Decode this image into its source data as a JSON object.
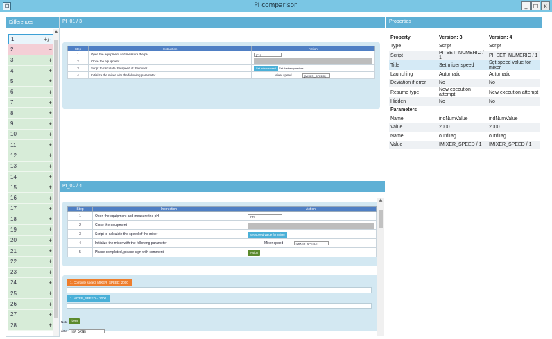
{
  "window": {
    "title": "PI comparison",
    "icon": "app-icon",
    "min": "_",
    "max": "□",
    "close": "x"
  },
  "differences": {
    "header": "Differences",
    "items": [
      {
        "n": "1",
        "sign": "+/-"
      },
      {
        "n": "2",
        "sign": "−"
      },
      {
        "n": "3",
        "sign": "+"
      },
      {
        "n": "4",
        "sign": "+"
      },
      {
        "n": "5",
        "sign": "+"
      },
      {
        "n": "6",
        "sign": "+"
      },
      {
        "n": "7",
        "sign": "+"
      },
      {
        "n": "8",
        "sign": "+"
      },
      {
        "n": "9",
        "sign": "+"
      },
      {
        "n": "10",
        "sign": "+"
      },
      {
        "n": "11",
        "sign": "+"
      },
      {
        "n": "12",
        "sign": "+"
      },
      {
        "n": "13",
        "sign": "+"
      },
      {
        "n": "14",
        "sign": "+"
      },
      {
        "n": "15",
        "sign": "+"
      },
      {
        "n": "16",
        "sign": "+"
      },
      {
        "n": "17",
        "sign": "+"
      },
      {
        "n": "18",
        "sign": "+"
      },
      {
        "n": "19",
        "sign": "+"
      },
      {
        "n": "20",
        "sign": "+"
      },
      {
        "n": "21",
        "sign": "+"
      },
      {
        "n": "22",
        "sign": "+"
      },
      {
        "n": "23",
        "sign": "+"
      },
      {
        "n": "24",
        "sign": "+"
      },
      {
        "n": "25",
        "sign": "+"
      },
      {
        "n": "26",
        "sign": "+"
      },
      {
        "n": "27",
        "sign": "+"
      },
      {
        "n": "28",
        "sign": "+"
      }
    ]
  },
  "version3": {
    "header": "PI_01 / 3",
    "columns": [
      "Step",
      "Instruction",
      "Action"
    ],
    "rows": [
      {
        "step": "1",
        "instruction": "Open the equipment and measure the pH",
        "action_input": "[PH]"
      },
      {
        "step": "2",
        "instruction": "Close the equipment"
      },
      {
        "step": "3",
        "instruction": "Script to calculate the speed of the mixer",
        "action_button": "Set mixer speed",
        "action_note": "Set the temperature"
      },
      {
        "step": "4",
        "instruction": "Initialize the mixer with the following parameter",
        "action_label": "Mixer speed",
        "action_input": "[MIXER_SPEED]"
      }
    ]
  },
  "version4": {
    "header": "PI_01 / 4",
    "columns": [
      "Step",
      "Instruction",
      "Action"
    ],
    "rows": [
      {
        "step": "1",
        "instruction": "Open the equipment and measure the pH",
        "action_input": "[PH]"
      },
      {
        "step": "2",
        "instruction": "Close the equipment"
      },
      {
        "step": "3",
        "instruction": "Script to calculate the speed of the mixer",
        "action_button": "Set speed value for mixer"
      },
      {
        "step": "4",
        "instruction": "Initialize the mixer with the following parameter",
        "action_label": "Mixer speed",
        "action_input": "[MIXER_SPEED]"
      },
      {
        "step": "5",
        "instruction": "Phase completed, please sign with comment",
        "action_button": "e-sign"
      }
    ],
    "compute_label": "1. Compute speed: MIXER_SPEED: 2000",
    "mixer_label": "1. MIXER_SPEED = 2000",
    "note_label": "Note",
    "note_button": "Item",
    "date_label": "date",
    "date_value": "[ISP_DATE]"
  },
  "properties": {
    "header": "Properties",
    "columns": [
      "Property",
      "Version: 3",
      "Version: 4"
    ],
    "rows": [
      {
        "p": "Type",
        "v3": "Script",
        "v4": "Script",
        "style": ""
      },
      {
        "p": "Script",
        "v3": "PI_SET_NUMERIC / 1",
        "v4": "PI_SET_NUMERIC / 1",
        "style": "alt"
      },
      {
        "p": "Title",
        "v3": "Set mixer speed",
        "v4": "Set speed value for mixer",
        "style": "hl"
      },
      {
        "p": "Launching",
        "v3": "Automatic",
        "v4": "Automatic",
        "style": ""
      },
      {
        "p": "Deviation if error",
        "v3": "No",
        "v4": "No",
        "style": "alt"
      },
      {
        "p": "Resume type",
        "v3": "New execution attempt",
        "v4": "New execution attempt",
        "style": ""
      },
      {
        "p": "Hidden",
        "v3": "No",
        "v4": "No",
        "style": "alt"
      }
    ],
    "params_header": "Parameters",
    "params": [
      {
        "p": "Name",
        "v3": "indNumValue",
        "v4": "indNumValue",
        "style": ""
      },
      {
        "p": "Value",
        "v3": "2000",
        "v4": "2000",
        "style": "alt"
      },
      {
        "p": "Name",
        "v3": "outdTag",
        "v4": "outdTag",
        "style": ""
      },
      {
        "p": "Value",
        "v3": "IMIXER_SPEED / 1",
        "v4": "IMIXER_SPEED / 1",
        "style": "alt"
      }
    ]
  },
  "colors": {
    "accent": "#5fb0d5",
    "table_header": "#4f7fc4",
    "diff_green": "#d7ecd8",
    "diff_pink": "#f4cfd6",
    "orange": "#ee7d2c",
    "green_button": "#5b8a2d"
  }
}
